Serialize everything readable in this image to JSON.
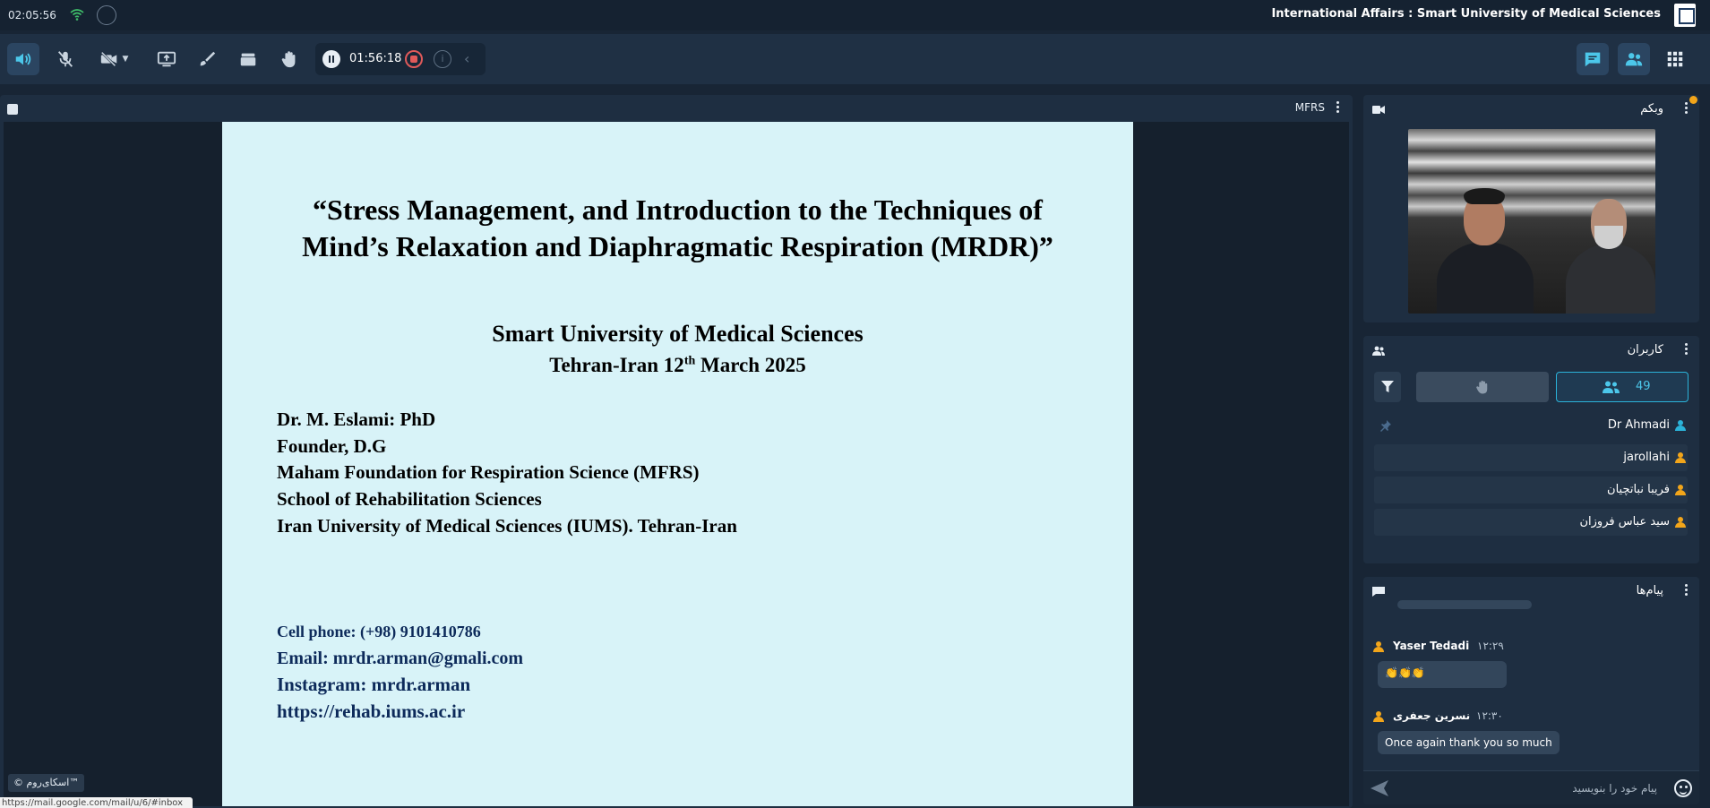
{
  "topbar": {
    "clock": "02:05:56",
    "org_title": "International Affairs : Smart University of Medical Sciences"
  },
  "toolbar": {
    "recording_time": "01:56:18",
    "info_label": "i",
    "chevron": "‹"
  },
  "presentation": {
    "file_name": "MFRS",
    "slide": {
      "title_line1": "“Stress Management, and Introduction to the Techniques of",
      "title_line2": "Mind’s Relaxation and Diaphragmatic Respiration (MRDR)”",
      "university": "Smart University of Medical Sciences",
      "date_prefix": "Tehran-Iran 12",
      "date_sup": "th",
      "date_suffix": " March 2025",
      "lines": [
        "Dr. M. Eslami: PhD",
        "Founder, D.G",
        "Maham Foundation for Respiration Science (MFRS)",
        "School of Rehabilitation Sciences",
        "Iran University of Medical Sciences (IUMS). Tehran-Iran"
      ],
      "contacts": [
        "Cell phone: (+98)  9101410786",
        "Email: mrdr.arman@gmali.com",
        "Instagram: mrdr.arman",
        "https://rehab.iums.ac.ir"
      ]
    },
    "brand_tag": "© اسکای‌روم™",
    "status_url": "https://mail.google.com/mail/u/6/#inbox"
  },
  "webcam": {
    "title": "وبکم"
  },
  "users": {
    "title": "کاربران",
    "count": "49",
    "list": [
      {
        "name": "Dr Ahmadi",
        "color": "#2bb3d9"
      },
      {
        "name": "jarollahi",
        "color": "#f2a51a"
      },
      {
        "name": "فریبا نباتچیان",
        "color": "#f2a51a"
      },
      {
        "name": "سید عباس فروزان",
        "color": "#f2a51a"
      }
    ]
  },
  "messages": {
    "title": "پیام‌ها",
    "items": [
      {
        "author": "Yaser Tedadi",
        "time": "۱۲:۲۹",
        "text": "👏👏👏"
      },
      {
        "author": "نسرین جعفری",
        "time": "۱۲:۳۰",
        "text": "Once again thank you so much"
      }
    ],
    "composer_placeholder": "پیام خود را بنویسید"
  },
  "colors": {
    "background": "#182535",
    "panel": "#1e2e41",
    "accent": "#2bb3d9",
    "slide_bg": "#d8f3f8",
    "user_color": "#f2a51a"
  }
}
